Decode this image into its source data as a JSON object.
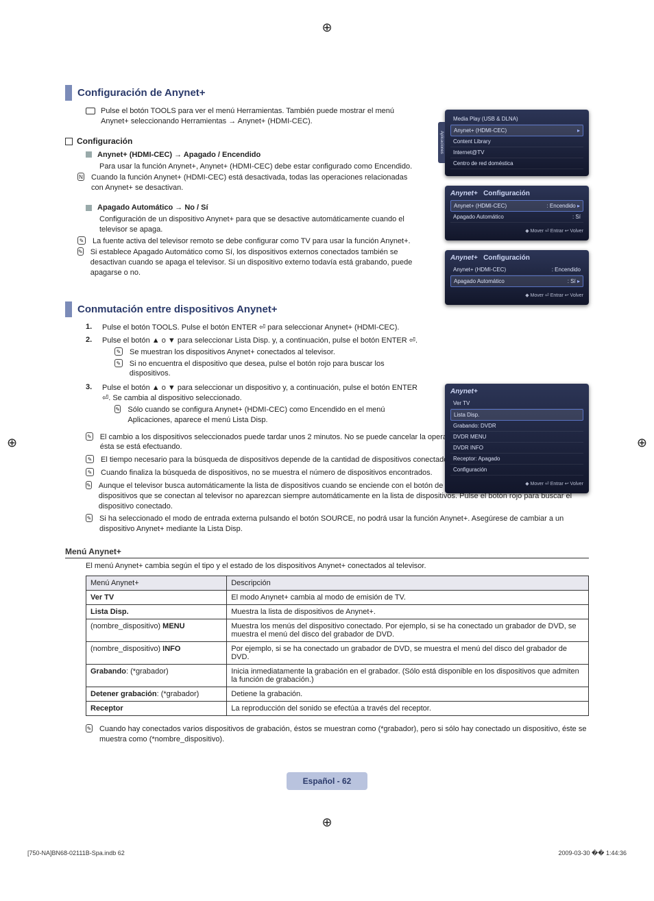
{
  "crop_glyph": "⊕",
  "section1": {
    "title": "Configuración de Anynet+",
    "intro": "Pulse el botón TOOLS para ver el menú Herramientas. También puede mostrar el menú Anynet+ seleccionando Herramientas → Anynet+ (HDMI-CEC).",
    "config_label": "Configuración",
    "item1_title": "Anynet+ (HDMI-CEC) → Apagado / Encendido",
    "item1_body": "Para usar la función Anynet+, Anynet+ (HDMI-CEC) debe estar configurado como Encendido.",
    "item1_note": "Cuando la función Anynet+ (HDMI-CEC) está desactivada, todas las operaciones relacionadas con Anynet+ se desactivan.",
    "item2_title": "Apagado Automático → No / Sí",
    "item2_body": "Configuración de un dispositivo Anynet+ para que se desactive automáticamente cuando el televisor se apaga.",
    "item2_note1": "La fuente activa del televisor remoto se debe configurar como TV para usar la función Anynet+.",
    "item2_note2": "Si establece Apagado Automático como Sí, los dispositivos externos conectados también se desactivan cuando se apaga el televisor. Si un dispositivo externo todavía está grabando, puede apagarse o no."
  },
  "section2": {
    "title": "Conmutación entre dispositivos Anynet+",
    "step1": "Pulse el botón TOOLS. Pulse el botón ENTER ⏎ para seleccionar Anynet+ (HDMI-CEC).",
    "step2": "Pulse el botón ▲ o ▼ para seleccionar Lista Disp. y, a continuación, pulse el botón ENTER ⏎.",
    "step2_n1": "Se muestran los dispositivos Anynet+ conectados al televisor.",
    "step2_n2": "Si no encuentra el dispositivo que desea, pulse el botón rojo para buscar los dispositivos.",
    "step3": "Pulse el botón ▲ o ▼ para seleccionar un dispositivo y, a continuación, pulse el botón ENTER ⏎. Se cambia al dispositivo seleccionado.",
    "step3_n1": "Sólo cuando se configura Anynet+ (HDMI-CEC) como Encendido en el menú Aplicaciones, aparece el menú Lista Disp.",
    "after1": "El cambio a los dispositivos seleccionados puede tardar unos 2 minutos. No se puede cancelar la operación de cambio de dispositivo mientras ésta se está efectuando.",
    "after2": "El tiempo necesario para la búsqueda de dispositivos depende de la cantidad de dispositivos conectados.",
    "after3": "Cuando finaliza la búsqueda de dispositivos, no se muestra el número de dispositivos encontrados.",
    "after4": "Aunque el televisor busca automáticamente la lista de dispositivos cuando se enciende con el botón de alimentación, es posible que los dispositivos que se conectan al televisor no aparezcan siempre automáticamente en la lista de dispositivos. Pulse el botón rojo para buscar el dispositivo conectado.",
    "after5": "Si ha seleccionado el modo de entrada externa pulsando el botón SOURCE, no podrá usar la función Anynet+. Asegúrese de cambiar a un dispositivo Anynet+ mediante la Lista Disp."
  },
  "menu": {
    "heading": "Menú Anynet+",
    "intro": "El menú Anynet+ cambia según el tipo y el estado de los dispositivos Anynet+ conectados al televisor.",
    "col1": "Menú Anynet+",
    "col2": "Descripción",
    "rows": [
      {
        "k": "Ver TV",
        "v": "El modo Anynet+ cambia al modo de emisión de TV."
      },
      {
        "k": "Lista Disp.",
        "v": "Muestra la lista de dispositivos de Anynet+."
      },
      {
        "k": "(nombre_dispositivo) MENU",
        "v": "Muestra los menús del dispositivo conectado. Por ejemplo, si se ha conectado un grabador de DVD, se muestra el menú del disco del grabador de DVD."
      },
      {
        "k": "(nombre_dispositivo) INFO",
        "v": "Por ejemplo, si se ha conectado un grabador de DVD, se muestra el menú del disco del grabador de DVD."
      },
      {
        "k": "Grabando: (*grabador)",
        "v": "Inicia inmediatamente la grabación en el grabador. (Sólo está disponible en los dispositivos que admiten la función de grabación.)"
      },
      {
        "k": "Detener grabación: (*grabador)",
        "v": "Detiene la grabación."
      },
      {
        "k": "Receptor",
        "v": "La reproducción del sonido se efectúa a través del receptor."
      }
    ],
    "footnote": "Cuando hay conectados varios dispositivos de grabación, éstos se muestran como (*grabador), pero si sólo hay conectado un dispositivo, éste se muestra como (*nombre_dispositivo)."
  },
  "ui1": {
    "sidebar": "Aplicaciones",
    "items": [
      "Media Play (USB & DLNA)",
      "Anynet+ (HDMI-CEC)",
      "Content Library",
      "Internet@TV",
      "Centro de red doméstica"
    ]
  },
  "ui2": {
    "brand": "Anynet+",
    "title": "Configuración",
    "r1k": "Anynet+ (HDMI-CEC)",
    "r1v": ": Encendido",
    "r2k": "Apagado Automático",
    "r2v": ": Sí",
    "foot": "◆ Mover    ⏎ Entrar    ↩ Volver"
  },
  "ui3": {
    "brand": "Anynet+",
    "items": [
      "Ver TV",
      "Lista Disp.",
      "Grabando: DVDR",
      "DVDR MENU",
      "DVDR INFO",
      "Receptor: Apagado",
      "Configuración"
    ],
    "sel_index": 1,
    "foot": "◆ Mover    ⏎ Entrar    ↩ Volver"
  },
  "footer": {
    "page_label": "Español - 62",
    "doc_left": "[750-NA]BN68-02111B-Spa.indb   62",
    "doc_right": "2009-03-30   �� 1:44:36"
  }
}
